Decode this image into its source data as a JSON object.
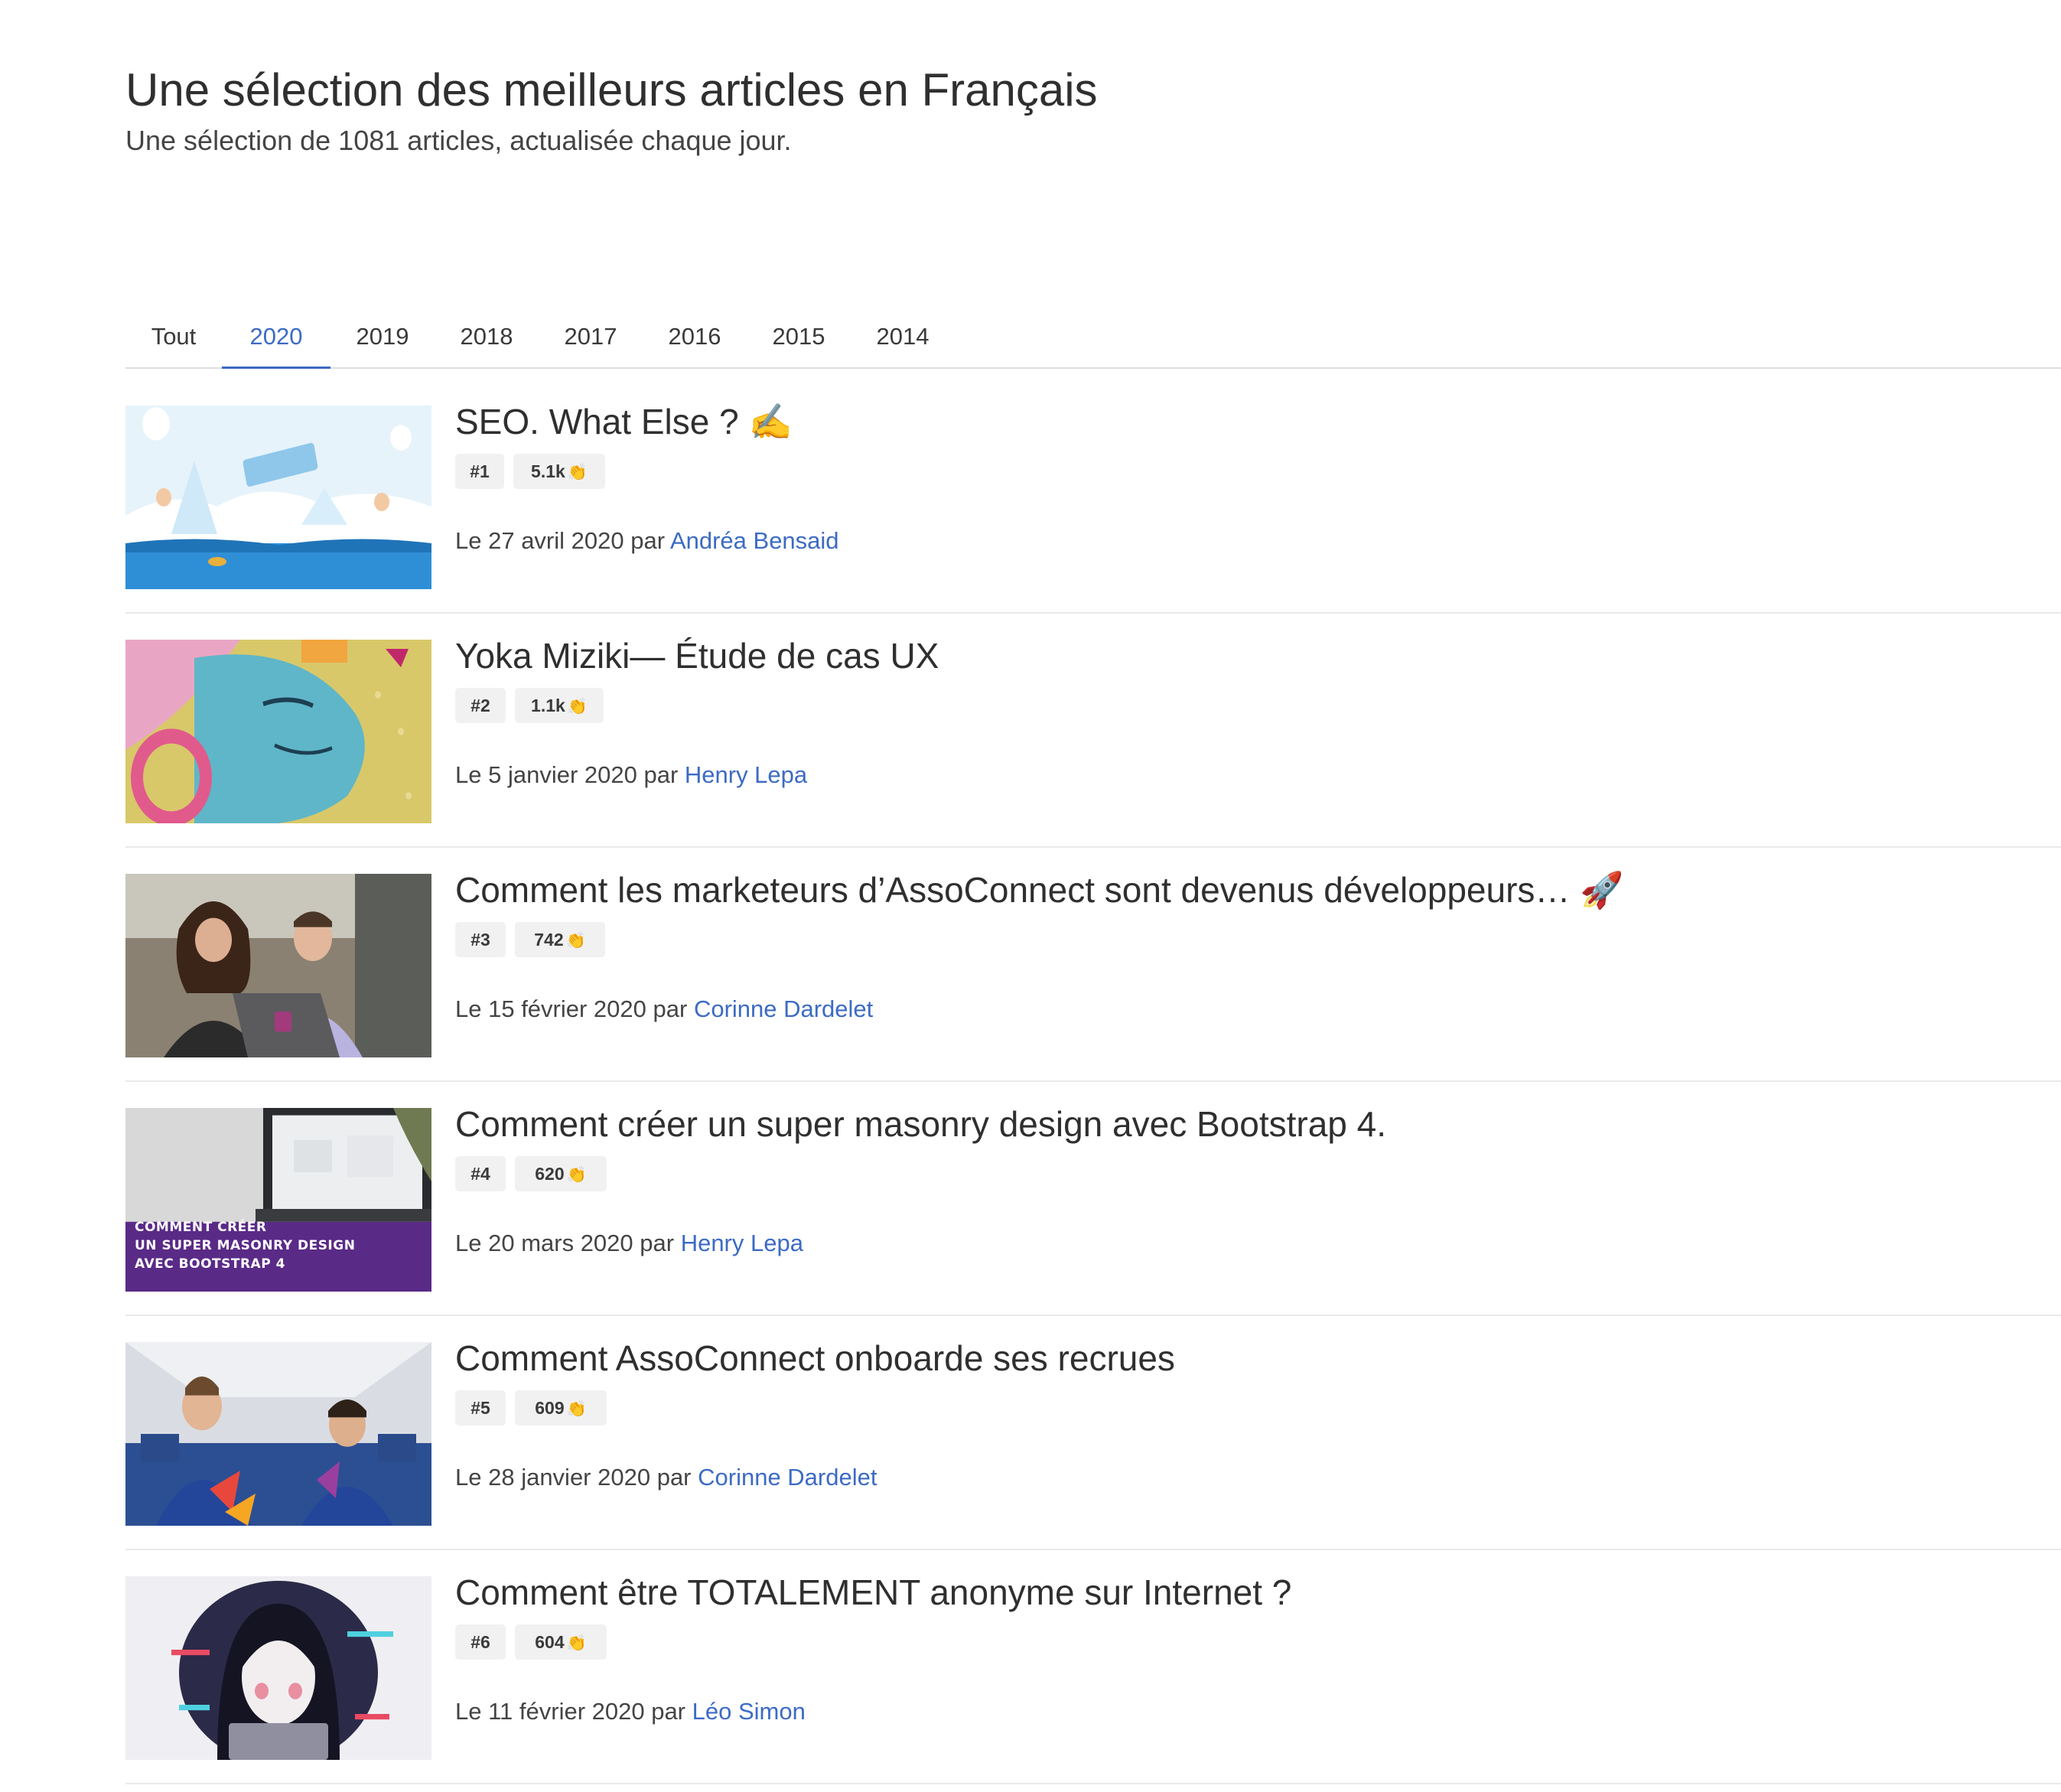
{
  "header": {
    "title": "Une sélection des meilleurs articles en Français",
    "subtitle": "Une sélection de 1081 articles, actualisée chaque jour."
  },
  "tabs": [
    {
      "label": "Tout",
      "active": false
    },
    {
      "label": "2020",
      "active": true
    },
    {
      "label": "2019",
      "active": false
    },
    {
      "label": "2018",
      "active": false
    },
    {
      "label": "2017",
      "active": false
    },
    {
      "label": "2016",
      "active": false
    },
    {
      "label": "2015",
      "active": false
    },
    {
      "label": "2014",
      "active": false
    }
  ],
  "articles": [
    {
      "title": "SEO. What Else ? ✍️",
      "rank": "#1",
      "claps": "5.1k",
      "meta_prefix": "Le 27 avril 2020 par ",
      "author": "Andréa Bensaid",
      "image": "content-marketing-illustration"
    },
    {
      "title": "Yoka Miziki— Étude de cas UX",
      "rank": "#2",
      "claps": "1.1k",
      "meta_prefix": "Le 5 janvier 2020 par ",
      "author": "Henry Lepa",
      "image": "headphone-face-illustration"
    },
    {
      "title": "Comment les marketeurs d’AssoConnect sont devenus développeurs… 🚀",
      "rank": "#3",
      "claps": "742",
      "meta_prefix": "Le 15 février 2020 par ",
      "author": "Corinne Dardelet",
      "image": "two-people-laptop-photo"
    },
    {
      "title": "Comment créer un super masonry design avec Bootstrap 4.",
      "rank": "#4",
      "claps": "620",
      "meta_prefix": "Le 20 mars 2020 par ",
      "author": "Henry Lepa",
      "image": "laptop-banner-photo",
      "image_text": [
        "COMMENT CRÉER",
        "UN SUPER MASONRY DESIGN",
        "AVEC BOOTSTRAP 4"
      ]
    },
    {
      "title": "Comment AssoConnect onboarde ses recrues",
      "rank": "#5",
      "claps": "609",
      "meta_prefix": "Le 28 janvier 2020 par ",
      "author": "Corinne Dardelet",
      "image": "airplane-crew-photo"
    },
    {
      "title": "Comment être TOTALEMENT anonyme sur Internet ?",
      "rank": "#6",
      "claps": "604",
      "meta_prefix": "Le 11 février 2020 par ",
      "author": "Léo Simon",
      "image": "hooded-hacker-illustration"
    }
  ],
  "icons": {
    "clap": "clapping-hands-icon"
  },
  "colors": {
    "accent": "#3c6bc4",
    "badge_bg": "#f1f1f1",
    "divider": "#eaeaea"
  }
}
